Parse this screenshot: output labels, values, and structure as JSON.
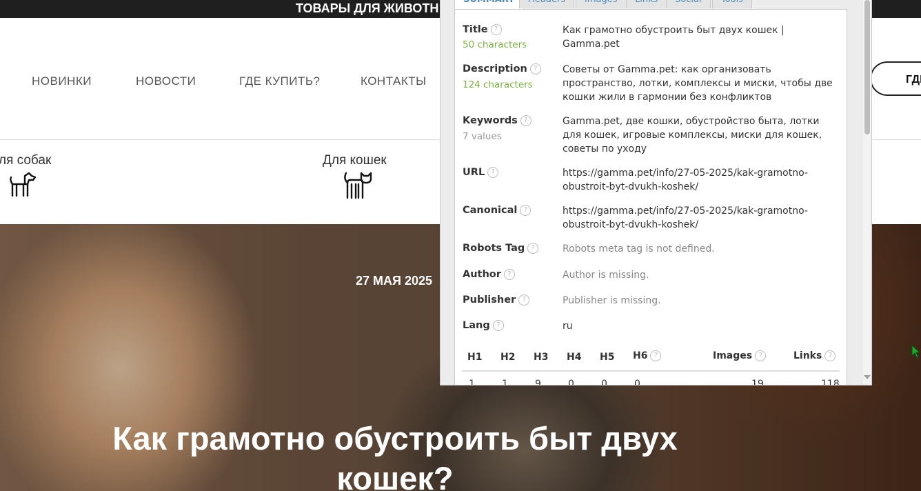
{
  "site": {
    "topbar_text": "ТОВАРЫ ДЛЯ ЖИВОТН",
    "nav": [
      "НОВИНКИ",
      "НОВОСТИ",
      "ГДЕ КУПИТЬ?",
      "КОНТАКТЫ"
    ],
    "nav_button": "ГДЕ",
    "categories": [
      {
        "label": "ля собак",
        "icon": "dog-icon"
      },
      {
        "label": "Для кошек",
        "icon": "cat-icon"
      }
    ]
  },
  "hero": {
    "date": "27 МАЯ 2025",
    "title": "Как грамотно обустроить быт двух кошек?"
  },
  "seo_panel": {
    "tabs": [
      "SUMMARY",
      "Headers",
      "Images",
      "Links",
      "Social",
      "Tools"
    ],
    "rows": {
      "title": {
        "label": "Title",
        "sub": "50 characters",
        "value": "Как грамотно обустроить быт двух кошек | Gamma.pet"
      },
      "description": {
        "label": "Description",
        "sub": "124 characters",
        "value": "Советы от Gamma.pet: как организовать пространство, лотки, комплексы и миски, чтобы две кошки жили в гармонии без конфликтов"
      },
      "keywords": {
        "label": "Keywords",
        "sub": "7 values",
        "value": "Gamma.pet, две кошки, обустройство быта, лотки для кошек, игровые комплексы, миски для кошек, советы по уходу"
      },
      "url": {
        "label": "URL",
        "value": "https://gamma.pet/info/27-05-2025/kak-gramotno-obustroit-byt-dvukh-koshek/"
      },
      "canonical": {
        "label": "Canonical",
        "value": "https://gamma.pet/info/27-05-2025/kak-gramotno-obustroit-byt-dvukh-koshek/"
      },
      "robots": {
        "label": "Robots Tag",
        "value": "Robots meta tag is not defined."
      },
      "author": {
        "label": "Author",
        "value": "Author is missing."
      },
      "publisher": {
        "label": "Publisher",
        "value": "Publisher is missing."
      },
      "lang": {
        "label": "Lang",
        "value": "ru"
      }
    },
    "headings": {
      "labels": [
        "H1",
        "H2",
        "H3",
        "H4",
        "H5",
        "H6",
        "Images",
        "Links"
      ],
      "values": [
        "1",
        "1",
        "9",
        "0",
        "0",
        "0",
        "19",
        "118"
      ]
    },
    "help_glyph": "?"
  },
  "colors": {
    "green_count": "#7cb342",
    "tab_link": "#4a8ab8",
    "topbar": "#1f1f1f"
  }
}
